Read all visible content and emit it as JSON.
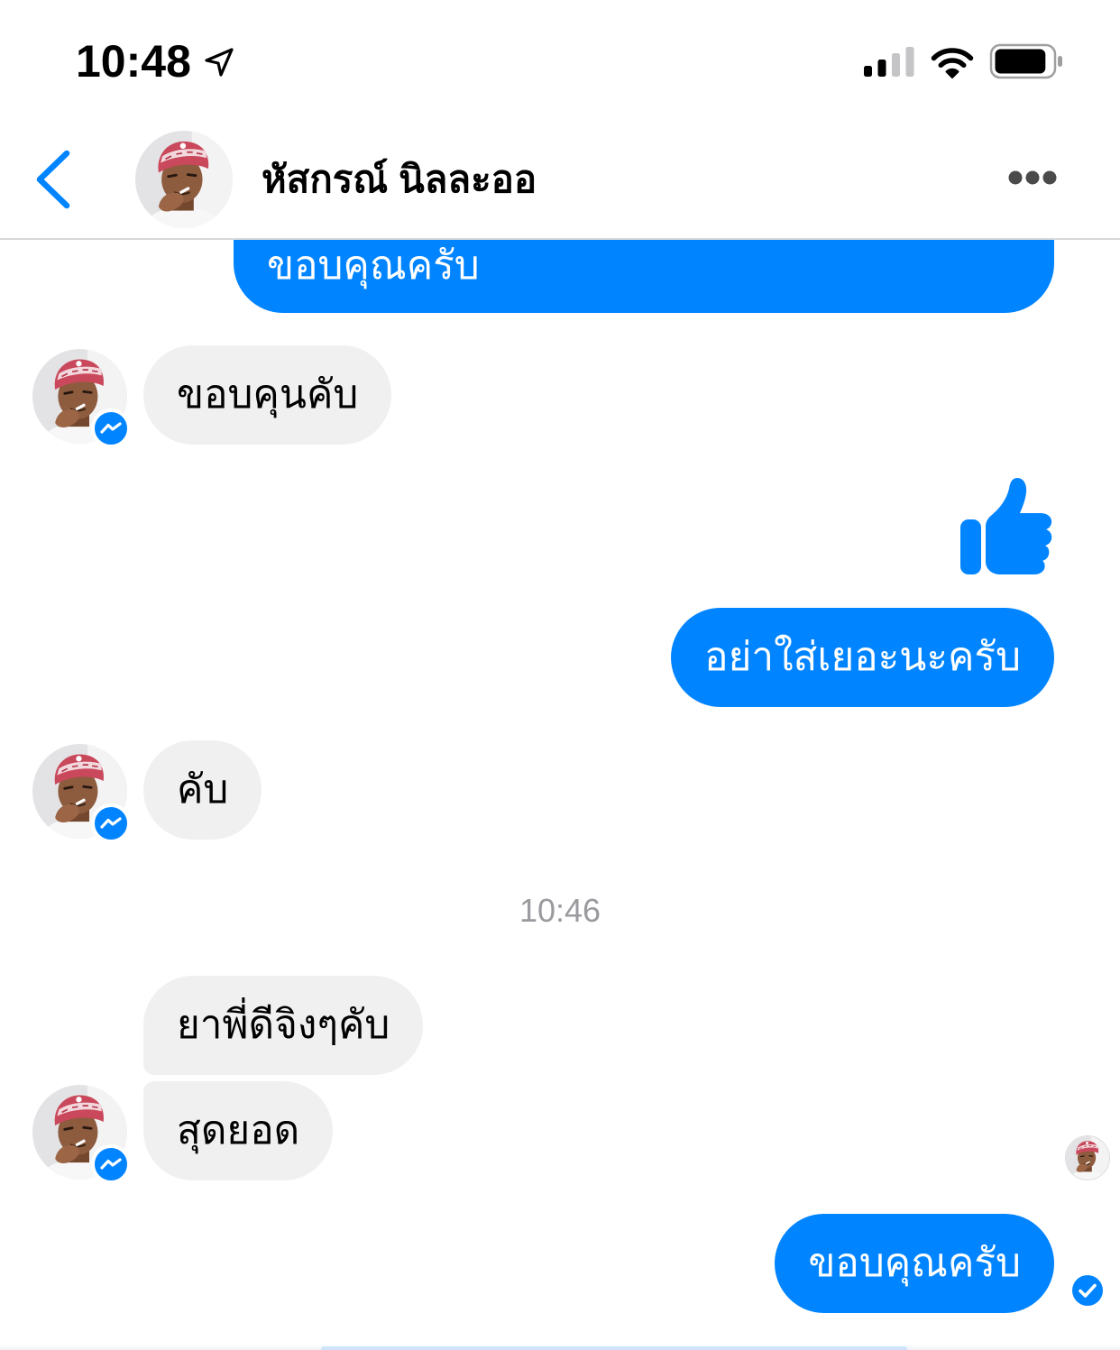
{
  "status_bar": {
    "time": "10:48",
    "location_icon": "location-arrow-icon",
    "signal_icon": "cellular-signal-icon",
    "signal_bars_active": 2,
    "signal_bars_total": 4,
    "wifi_icon": "wifi-icon",
    "battery_icon": "battery-icon",
    "battery_level": 0.9
  },
  "header": {
    "back_icon": "chevron-left-icon",
    "contact_name": "หัสกรณ์ นิลละออ",
    "more_icon": "more-horizontal-icon"
  },
  "conversation": {
    "messages": [
      {
        "text": "ขอบคุณครับ"
      },
      {
        "text": "ขอบคุนคับ"
      },
      {
        "icon": "thumbs-up-icon"
      },
      {
        "text": "อย่าใส่เยอะนะครับ"
      },
      {
        "text": "คับ"
      },
      {
        "text": "ยาพี่ดีจิงๆคับ"
      },
      {
        "text": "สุดยอด"
      },
      {
        "text": "ขอบคุณครับ",
        "status_icon": "delivered-check-icon"
      }
    ],
    "time_divider": "10:46",
    "sender_badge_icon": "messenger-badge-icon"
  },
  "colors": {
    "accent": "#0084ff",
    "sent_bubble": "#0084ff",
    "received_bubble": "#f0f0f0",
    "timestamp": "#9a9a9f",
    "divider": "#d8d8d8"
  }
}
